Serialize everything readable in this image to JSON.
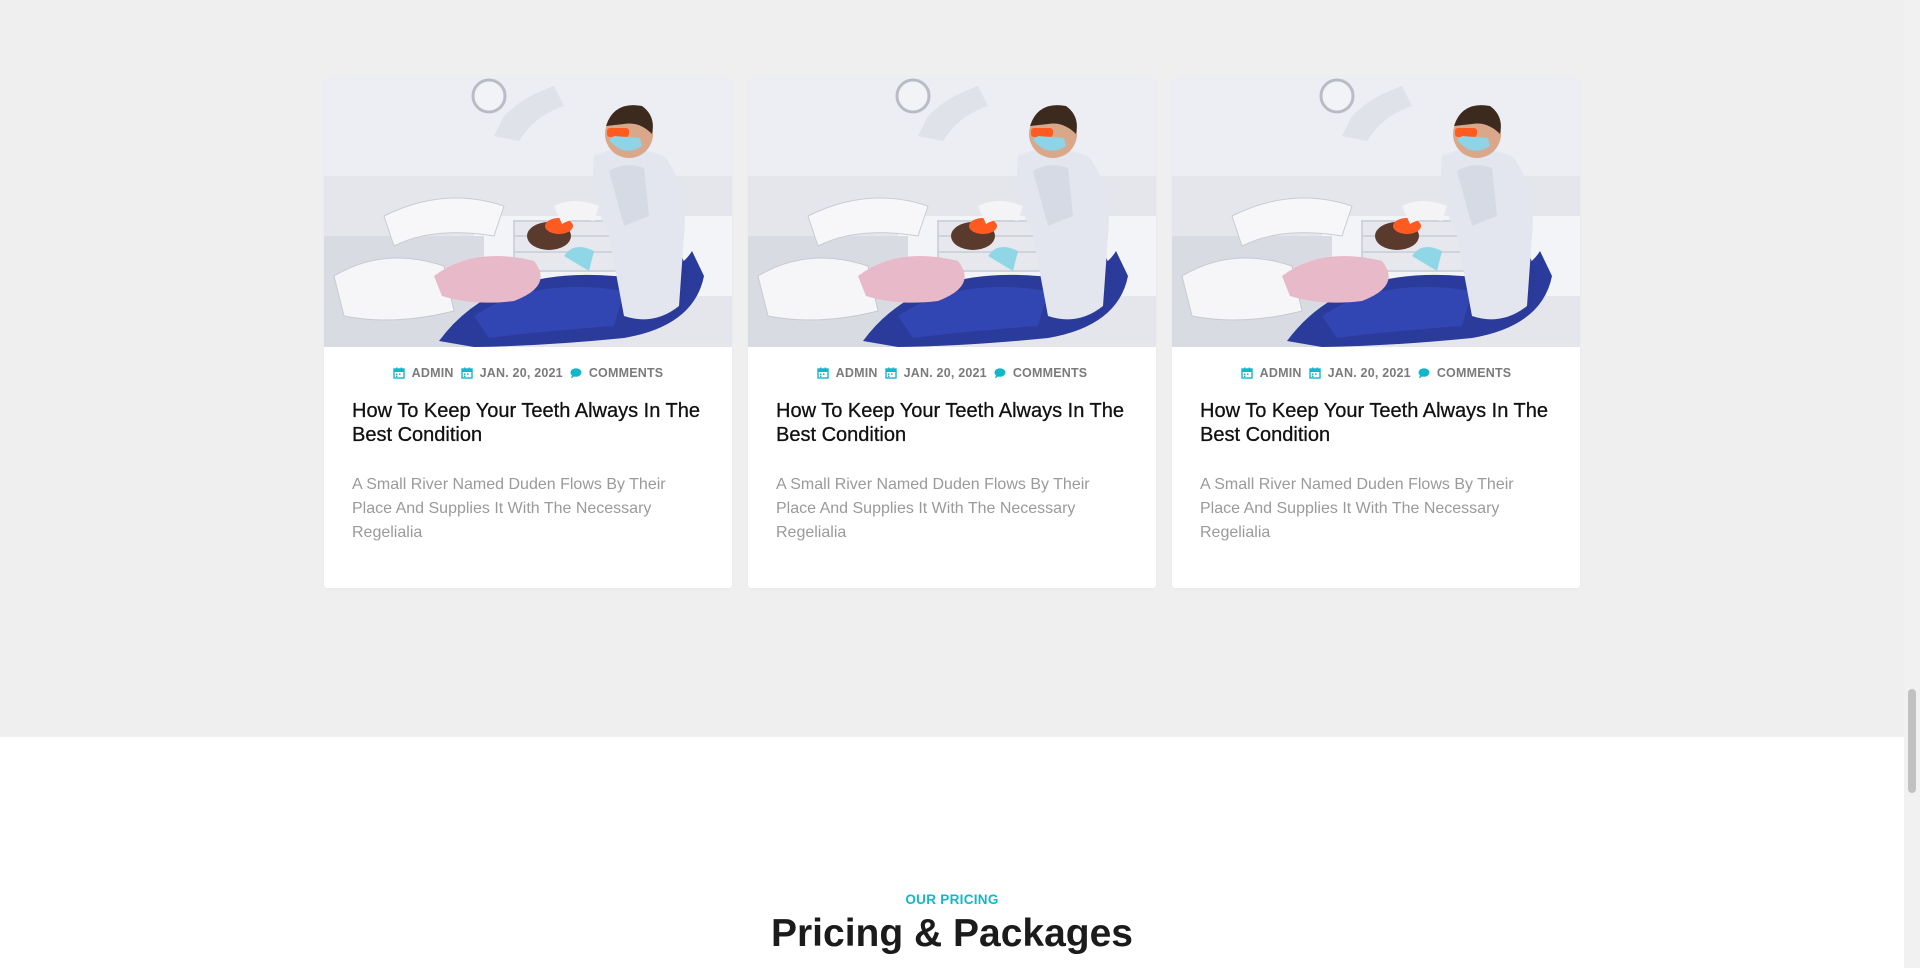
{
  "colors": {
    "section_background": "#efefef",
    "accent": "#12b7c9",
    "title_text": "#111111",
    "muted_text": "#9a9a9a"
  },
  "blog": {
    "posts": [
      {
        "image_alt": "Dentist examining a patient in a dental chair",
        "author": "ADMIN",
        "date": "JAN. 20, 2021",
        "comments": "COMMENTS",
        "title": "How To Keep Your Teeth Always In The Best Condition",
        "excerpt": "A Small River Named Duden Flows By Their Place And Supplies It With The Necessary Regelialia",
        "icons": [
          "calendar-icon",
          "calendar-icon",
          "chat-bubble-icon"
        ]
      },
      {
        "image_alt": "Dentist examining a patient in a dental chair",
        "author": "ADMIN",
        "date": "JAN. 20, 2021",
        "comments": "COMMENTS",
        "title": "How To Keep Your Teeth Always In The Best Condition",
        "excerpt": "A Small River Named Duden Flows By Their Place And Supplies It With The Necessary Regelialia",
        "icons": [
          "calendar-icon",
          "calendar-icon",
          "chat-bubble-icon"
        ]
      },
      {
        "image_alt": "Dentist examining a patient in a dental chair",
        "author": "ADMIN",
        "date": "JAN. 20, 2021",
        "comments": "COMMENTS",
        "title": "How To Keep Your Teeth Always In The Best Condition",
        "excerpt": "A Small River Named Duden Flows By Their Place And Supplies It With The Necessary Regelialia",
        "icons": [
          "calendar-icon",
          "calendar-icon",
          "chat-bubble-icon"
        ]
      }
    ]
  },
  "pricing": {
    "eyebrow": "OUR PRICING",
    "title": "Pricing & Packages"
  }
}
